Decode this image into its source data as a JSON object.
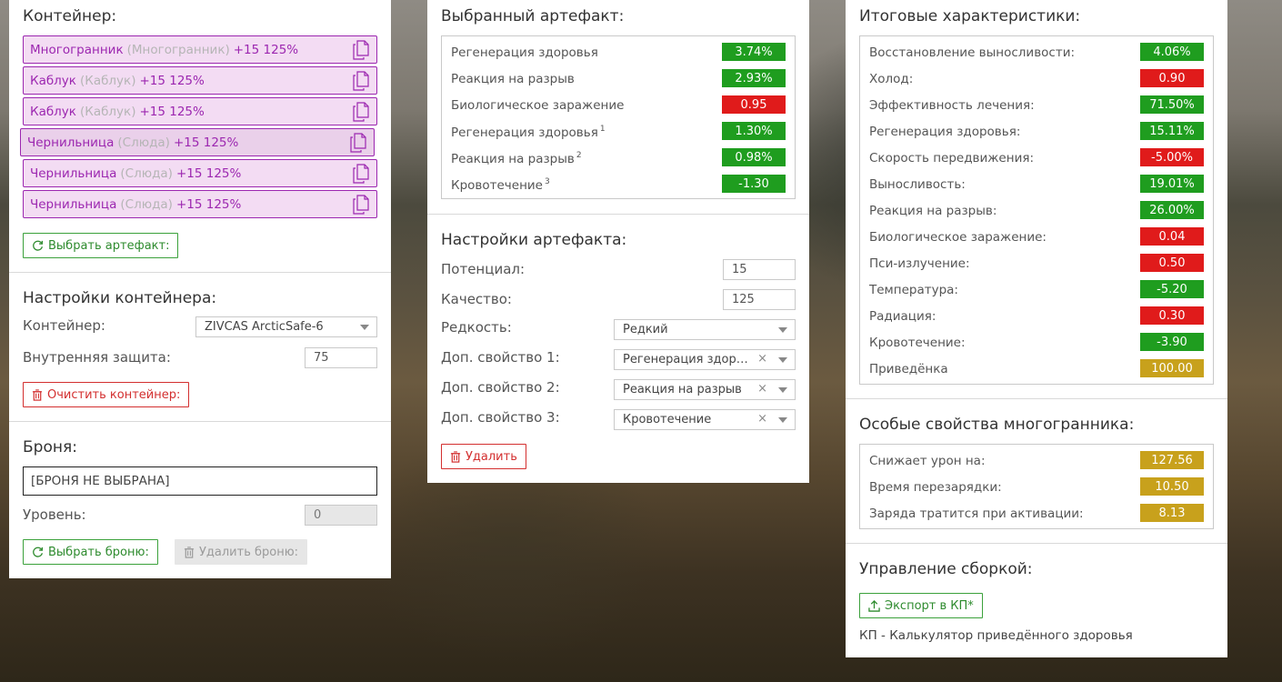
{
  "container_section": {
    "title": "Контейнер:",
    "artifacts": [
      {
        "name": "Многогранник",
        "alt": "(Многогранник)",
        "stats": "+15 125%"
      },
      {
        "name": "Каблук",
        "alt": "(Каблук)",
        "stats": "+15 125%"
      },
      {
        "name": "Каблук",
        "alt": "(Каблук)",
        "stats": "+15 125%"
      },
      {
        "name": "Чернильница",
        "alt": "(Слюда)",
        "stats": "+15 125%"
      },
      {
        "name": "Чернильница",
        "alt": "(Слюда)",
        "stats": "+15 125%"
      },
      {
        "name": "Чернильница",
        "alt": "(Слюда)",
        "stats": "+15 125%"
      }
    ],
    "select_artifact_btn": "Выбрать артефакт:"
  },
  "container_settings": {
    "title": "Настройки контейнера:",
    "container_label": "Контейнер:",
    "container_value": "ZIVCAS ArcticSafe-6",
    "protection_label": "Внутренняя защита:",
    "protection_value": "75",
    "clear_btn": "Очистить контейнер:"
  },
  "armor": {
    "title": "Броня:",
    "value": "[БРОНЯ НЕ ВЫБРАНА]",
    "level_label": "Уровень:",
    "level_value": "0",
    "select_btn": "Выбрать броню:",
    "delete_btn": "Удалить броню:"
  },
  "selected_artifact": {
    "title": "Выбранный артефакт:",
    "stats": [
      {
        "label": "Регенерация здоровья",
        "sup": "",
        "value": "3.74%",
        "color": "green"
      },
      {
        "label": "Реакция на разрыв",
        "sup": "",
        "value": "2.93%",
        "color": "green"
      },
      {
        "label": "Биологическое заражение",
        "sup": "",
        "value": "0.95",
        "color": "red"
      },
      {
        "label": "Регенерация здоровья",
        "sup": "1",
        "value": "1.30%",
        "color": "green"
      },
      {
        "label": "Реакция на разрыв",
        "sup": "2",
        "value": "0.98%",
        "color": "green"
      },
      {
        "label": "Кровотечение",
        "sup": "3",
        "value": "-1.30",
        "color": "green"
      }
    ]
  },
  "artifact_settings": {
    "title": "Настройки артефакта:",
    "potential_label": "Потенциал:",
    "potential_value": "15",
    "quality_label": "Качество:",
    "quality_value": "125",
    "rarity_label": "Редкость:",
    "rarity_value": "Редкий",
    "prop1_label": "Доп. свойство 1:",
    "prop1_value": "Регенерация здоровья",
    "prop2_label": "Доп. свойство 2:",
    "prop2_value": "Реакция на разрыв",
    "prop3_label": "Доп. свойство 3:",
    "prop3_value": "Кровотечение",
    "clear_x": "×",
    "delete_btn": "Удалить"
  },
  "totals": {
    "title": "Итоговые характеристики:",
    "stats": [
      {
        "label": "Восстановление выносливости:",
        "value": "4.06%",
        "color": "green"
      },
      {
        "label": "Холод:",
        "value": "0.90",
        "color": "red"
      },
      {
        "label": "Эффективность лечения:",
        "value": "71.50%",
        "color": "green"
      },
      {
        "label": "Регенерация здоровья:",
        "value": "15.11%",
        "color": "green"
      },
      {
        "label": "Скорость передвижения:",
        "value": "-5.00%",
        "color": "red"
      },
      {
        "label": "Выносливость:",
        "value": "19.01%",
        "color": "green"
      },
      {
        "label": "Реакция на разрыв:",
        "value": "26.00%",
        "color": "green"
      },
      {
        "label": "Биологическое заражение:",
        "value": "0.04",
        "color": "red"
      },
      {
        "label": "Пси-излучение:",
        "value": "0.50",
        "color": "red"
      },
      {
        "label": "Температура:",
        "value": "-5.20",
        "color": "green"
      },
      {
        "label": "Радиация:",
        "value": "0.30",
        "color": "red"
      },
      {
        "label": "Кровотечение:",
        "value": "-3.90",
        "color": "green"
      },
      {
        "label": "Приведёнка",
        "value": "100.00",
        "color": "gold"
      }
    ]
  },
  "special": {
    "title": "Особые свойства многогранника:",
    "stats": [
      {
        "label": "Снижает урон на:",
        "value": "127.56",
        "color": "gold"
      },
      {
        "label": "Время перезарядки:",
        "value": "10.50",
        "color": "gold"
      },
      {
        "label": "Заряда тратится при активации:",
        "value": "8.13",
        "color": "gold"
      }
    ]
  },
  "build": {
    "title": "Управление сборкой:",
    "export_btn": "Экспорт в КП*",
    "footnote": "КП - Калькулятор приведённого здоровья"
  },
  "colors": {
    "green": "#1f9d1f",
    "red": "#e01b1b",
    "gold": "#c8a11c",
    "purple": "#9c27b0"
  }
}
